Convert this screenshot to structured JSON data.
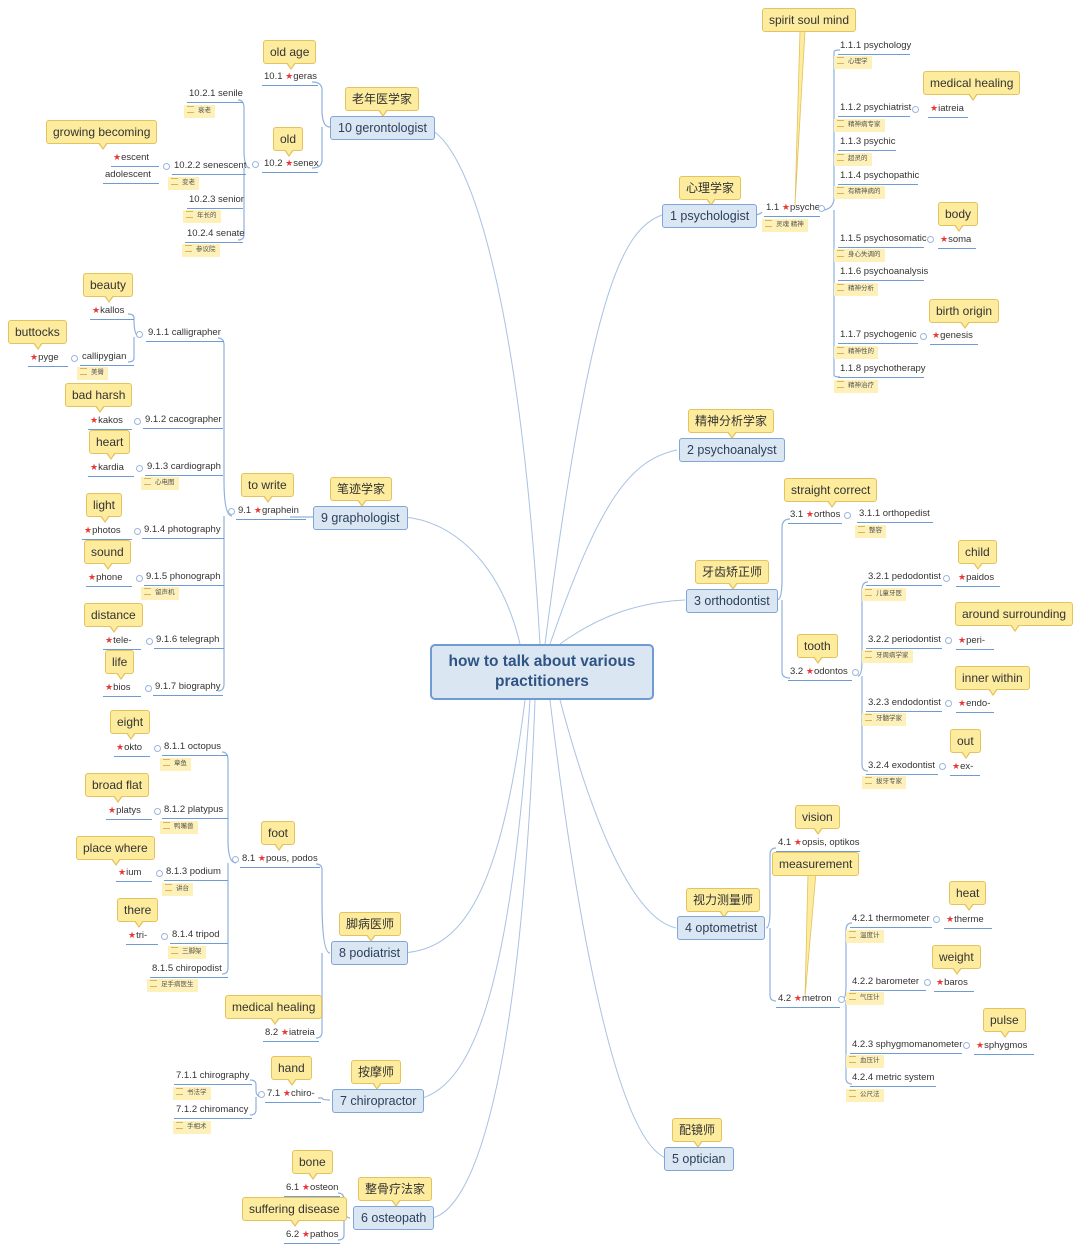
{
  "central": {
    "title": "how to talk about various practitioners"
  },
  "colors": {
    "accent": "#6f9bd3",
    "node_fill": "#dbe6f3",
    "callout_fill": "#fdeb9e",
    "star": "#e53935"
  },
  "branches": [
    {
      "id": 1,
      "label": "1 psychologist",
      "callout": "心理学家",
      "roots": [
        {
          "label": "1.1",
          "root": "psyche",
          "callout": "spirit soul mind",
          "note": "灵魂 精神",
          "children": [
            {
              "label": "1.1.1 psychology",
              "note": "心理学"
            },
            {
              "label": "1.1.2 psychiatrist",
              "note": "精神病专家",
              "root": "iatreia",
              "callout": "medical healing"
            },
            {
              "label": "1.1.3 psychic",
              "note": "超灵的"
            },
            {
              "label": "1.1.4 psychopathic",
              "note": "有精神病的"
            },
            {
              "label": "1.1.5 psychosomatic",
              "note": "身心失调的",
              "root": "soma",
              "callout": "body"
            },
            {
              "label": "1.1.6 psychoanalysis",
              "note": "精神分析"
            },
            {
              "label": "1.1.7 psychogenic",
              "note": "精神性的",
              "root": "genesis",
              "callout": "birth origin"
            },
            {
              "label": "1.1.8 psychotherapy",
              "note": "精神治疗"
            }
          ]
        }
      ]
    },
    {
      "id": 2,
      "label": "2 psychoanalyst",
      "callout": "精神分析学家",
      "roots": []
    },
    {
      "id": 3,
      "label": "3 orthodontist",
      "callout": "牙齿矫正师",
      "roots": [
        {
          "label": "3.1",
          "root": "orthos",
          "callout": "straight correct",
          "children": [
            {
              "label": "3.1.1 orthopedist",
              "note": "整容"
            }
          ]
        },
        {
          "label": "3.2",
          "root": "odontos",
          "callout": "tooth",
          "children": [
            {
              "label": "3.2.1 pedodontist",
              "note": "儿童牙医",
              "root": "paidos",
              "callout": "child"
            },
            {
              "label": "3.2.2 periodontist",
              "note": "牙周病学家",
              "root": "peri-",
              "callout": "around surrounding"
            },
            {
              "label": "3.2.3 endodontist",
              "note": "牙髓学家",
              "root": "endo-",
              "callout": "inner within"
            },
            {
              "label": "3.2.4 exodontist",
              "note": "拔牙专家",
              "root": "ex-",
              "callout": "out"
            }
          ]
        }
      ]
    },
    {
      "id": 4,
      "label": "4 optometrist",
      "callout": "视力测量师",
      "roots": [
        {
          "label": "4.1",
          "root": "opsis, optikos",
          "callout": "vision",
          "children": []
        },
        {
          "label": "4.2",
          "root": "metron",
          "callout": "measurement",
          "children": [
            {
              "label": "4.2.1 thermometer",
              "note": "温度计",
              "root": "therme",
              "callout": "heat"
            },
            {
              "label": "4.2.2 barometer",
              "note": "气压计",
              "root": "baros",
              "callout": "weight"
            },
            {
              "label": "4.2.3 sphygmomanometer",
              "note": "血压计",
              "root": "sphygmos",
              "callout": "pulse"
            },
            {
              "label": "4.2.4 metric system",
              "note": "公尺法"
            }
          ]
        }
      ]
    },
    {
      "id": 5,
      "label": "5 optician",
      "callout": "配镜师",
      "roots": []
    },
    {
      "id": 6,
      "label": "6 osteopath",
      "callout": "整骨疗法家",
      "roots": [
        {
          "label": "6.1",
          "root": "osteon",
          "callout": "bone",
          "children": []
        },
        {
          "label": "6.2",
          "root": "pathos",
          "callout": "suffering disease",
          "children": []
        }
      ]
    },
    {
      "id": 7,
      "label": "7 chiropractor",
      "callout": "按摩师",
      "roots": [
        {
          "label": "7.1",
          "root": "chiro-",
          "callout": "hand",
          "children": [
            {
              "label": "7.1.1 chirography",
              "note": "书法学"
            },
            {
              "label": "7.1.2 chiromancy",
              "note": "手相术"
            }
          ]
        }
      ]
    },
    {
      "id": 8,
      "label": "8 podiatrist",
      "callout": "脚病医师",
      "roots": [
        {
          "label": "8.1",
          "root": "pous, podos",
          "callout": "foot",
          "children": [
            {
              "label": "8.1.1 octopus",
              "note": "章鱼",
              "root": "okto",
              "callout": "eight"
            },
            {
              "label": "8.1.2 platypus",
              "note": "鸭嘴兽",
              "root": "platys",
              "callout": "broad flat"
            },
            {
              "label": "8.1.3 podium",
              "note": "讲台",
              "root": "ium",
              "callout": "place where"
            },
            {
              "label": "8.1.4 tripod",
              "note": "三脚架",
              "root": "tri-",
              "callout": "there"
            },
            {
              "label": "8.1.5 chiropodist",
              "note": "足手病医生"
            }
          ]
        },
        {
          "label": "8.2",
          "root": "iatreia",
          "callout": "medical healing",
          "children": []
        }
      ]
    },
    {
      "id": 9,
      "label": "9 graphologist",
      "callout": "笔迹学家",
      "roots": [
        {
          "label": "9.1",
          "root": "graphein",
          "callout": "to write",
          "children": [
            {
              "label": "9.1.1 calligrapher",
              "subroots": [
                {
                  "root": "kallos",
                  "callout": "beauty"
                },
                {
                  "label": "callipygian",
                  "note": "美臀",
                  "root": "pyge",
                  "callout": "buttocks"
                }
              ]
            },
            {
              "label": "9.1.2 cacographer",
              "root": "kakos",
              "callout": "bad harsh"
            },
            {
              "label": "9.1.3 cardiograph",
              "note": "心电图",
              "root": "kardia",
              "callout": "heart"
            },
            {
              "label": "9.1.4 photography",
              "root": "photos",
              "callout": "light"
            },
            {
              "label": "9.1.5 phonograph",
              "note": "留声机",
              "root": "phone",
              "callout": "sound"
            },
            {
              "label": "9.1.6 telegraph",
              "root": "tele-",
              "callout": "distance"
            },
            {
              "label": "9.1.7 biography",
              "root": "bios",
              "callout": "life"
            }
          ]
        }
      ]
    },
    {
      "id": 10,
      "label": "10 gerontologist",
      "callout": "老年医学家",
      "roots": [
        {
          "label": "10.1",
          "root": "geras",
          "callout": "old age",
          "children": []
        },
        {
          "label": "10.2",
          "root": "senex",
          "callout": "old",
          "children": [
            {
              "label": "10.2.1 senile",
              "note": "衰老"
            },
            {
              "label": "10.2.2 senescent",
              "note": "变老",
              "subroots": [
                {
                  "root": "escent",
                  "callout": "growing becoming"
                },
                {
                  "label": "adolescent"
                }
              ]
            },
            {
              "label": "10.2.3 senior",
              "note": "年长的"
            },
            {
              "label": "10.2.4 senate",
              "note": "参议院"
            }
          ]
        }
      ]
    }
  ]
}
